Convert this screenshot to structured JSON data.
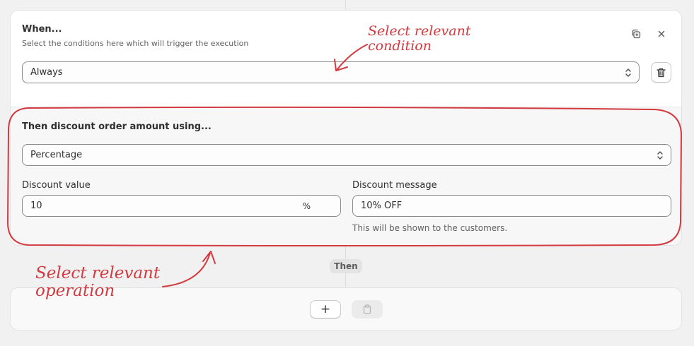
{
  "when": {
    "title": "When...",
    "subtitle": "Select the conditions here which will trigger the execution",
    "condition_value": "Always"
  },
  "then": {
    "title": "Then discount order amount using...",
    "method_value": "Percentage",
    "discount_value": {
      "label": "Discount value",
      "value": "10",
      "suffix": "%"
    },
    "discount_message": {
      "label": "Discount message",
      "value": "10% OFF",
      "help": "This will be shown to the customers."
    }
  },
  "connector_label": "Then",
  "actions": {
    "add_label": "+"
  },
  "annotations": {
    "condition": [
      "Select relevant",
      "condition"
    ],
    "operation": [
      "Select relevant",
      "operation"
    ]
  },
  "icons": [
    "duplicate-icon",
    "close-icon",
    "select-chevron-icon",
    "trash-icon",
    "plus-icon",
    "clipboard-icon"
  ],
  "colors": {
    "annotation": "#d23a40",
    "background": "#f1f1f1"
  }
}
